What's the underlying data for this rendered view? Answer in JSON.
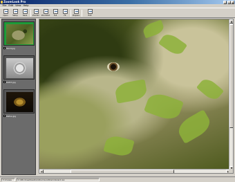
{
  "window": {
    "title": "ZoomLook Pro",
    "buttons": {
      "minimize": "_",
      "maximize": "□",
      "close": "×"
    }
  },
  "menu": [
    "File",
    "Edit",
    "View",
    "Help"
  ],
  "toolbar": {
    "tools": [
      {
        "name": "tool-open",
        "label": "Open"
      },
      {
        "name": "tool-setup",
        "label": "Setup"
      },
      {
        "name": "tool-save",
        "label": "Save"
      },
      {
        "name": "tool-zoom-in",
        "label": "ZoomIn"
      },
      {
        "name": "tool-zoom-out",
        "label": "ZoomOut"
      },
      {
        "name": "tool-full",
        "label": "Full"
      },
      {
        "name": "tool-fit",
        "label": "Fit"
      },
      {
        "name": "tool-prepare",
        "label": "Prepare"
      },
      {
        "name": "tool-exit",
        "label": "Exit"
      }
    ]
  },
  "sidebar": {
    "thumbnails": [
      {
        "caption": "lizard.jpg",
        "selected": true,
        "image": "iguana"
      },
      {
        "caption": "watch.jpg",
        "selected": false,
        "image": "watch"
      },
      {
        "caption": "statue.jpg",
        "selected": false,
        "image": "statue"
      }
    ]
  },
  "viewer": {
    "image": "iguana-photo"
  },
  "status": {
    "left": "3 images",
    "path": "C:\\Windows\\Desktop\\ZoomLook\\Demo\\lizard.jpg"
  },
  "colors": {
    "title_bar": "#0a246a",
    "chrome": "#d4d0c8",
    "sidebar_bg": "#6b6b6b",
    "selected_thumb": "#1d9b3a"
  }
}
